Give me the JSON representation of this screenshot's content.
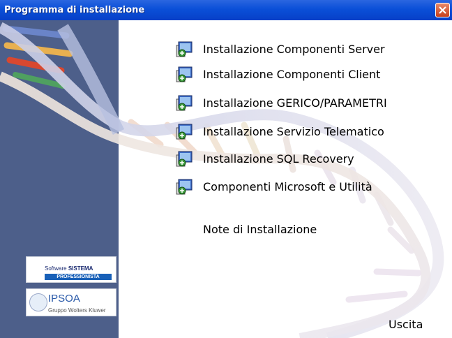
{
  "window": {
    "title": "Programma di installazione"
  },
  "menu": {
    "items": [
      {
        "label": "Installazione Componenti Server"
      },
      {
        "label": "Installazione Componenti Client"
      },
      {
        "label": "Installazione GERICO/PARAMETRI"
      },
      {
        "label": "Installazione Servizio Telematico"
      },
      {
        "label": "Installazione SQL Recovery"
      },
      {
        "label": "Componenti Microsoft e Utilità"
      }
    ],
    "notes_label": "Note di Installazione",
    "exit_label": "Uscita"
  },
  "logos": {
    "software": {
      "prefix": "Software",
      "name": "SISTEMA",
      "bar": "PROFESSIONISTA"
    },
    "ipsoa": {
      "name": "IPSOA",
      "sub": "Gruppo Wolters Kluwer"
    }
  },
  "colors": {
    "titlebar": "#0a4fd8",
    "sidebar": "#4d5f8a",
    "close": "#c8401c"
  }
}
